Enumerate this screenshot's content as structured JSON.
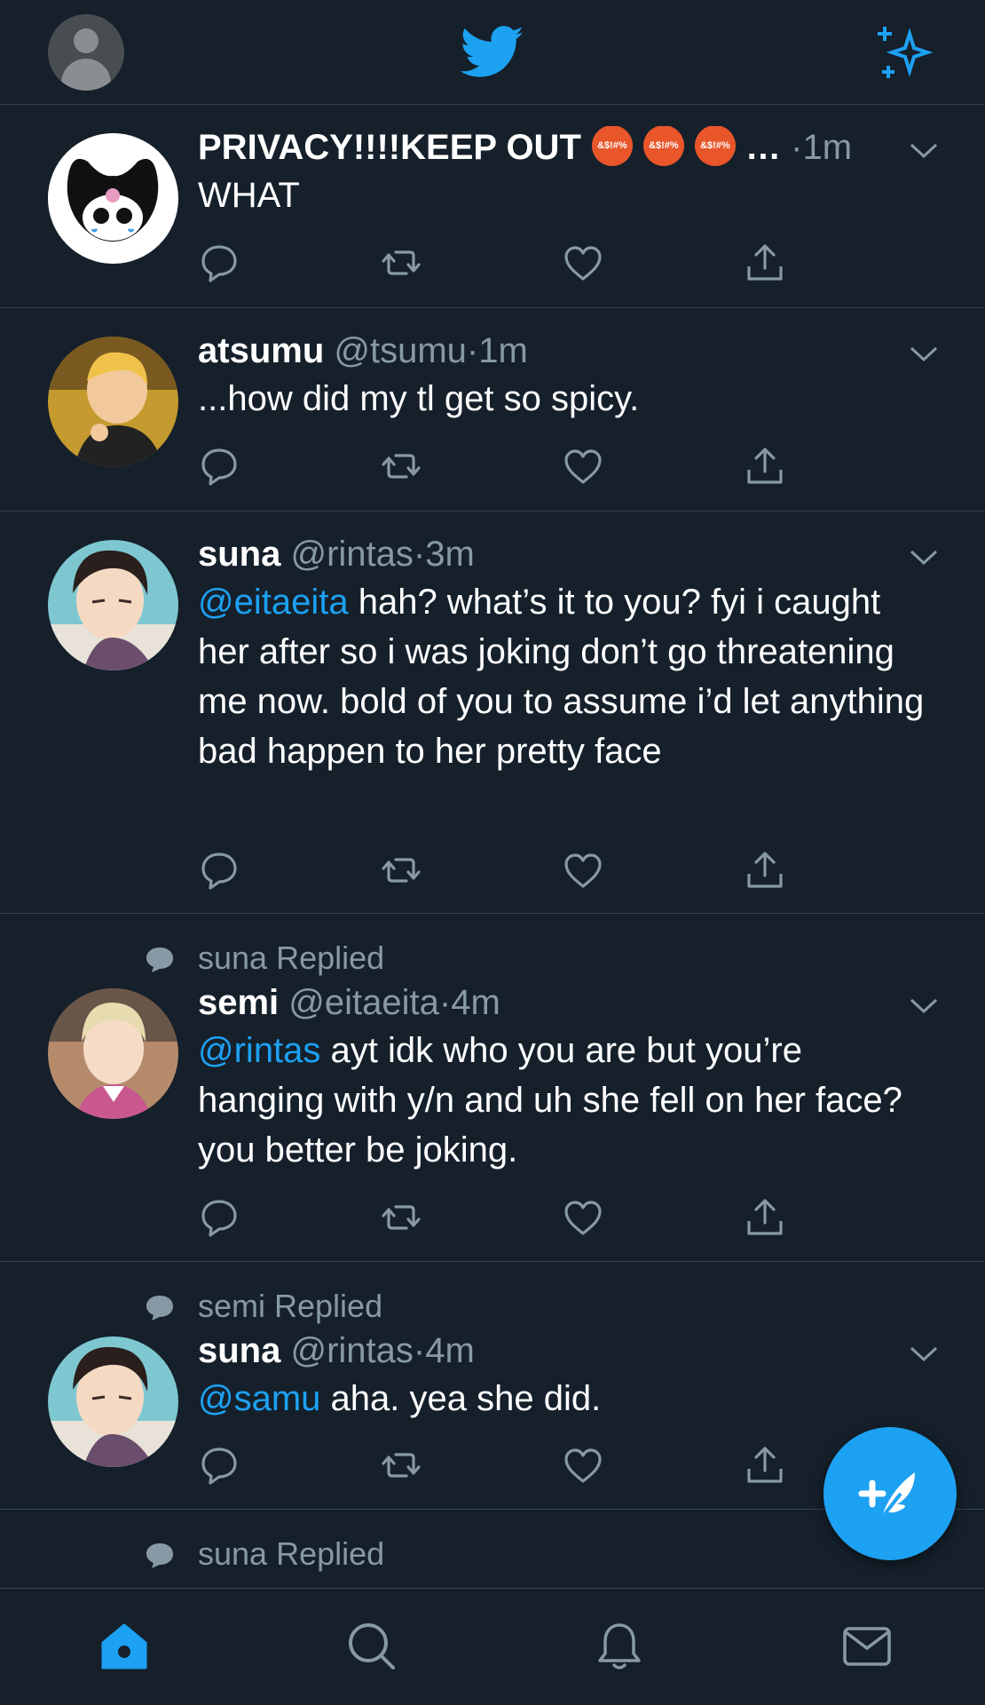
{
  "header": {
    "profile_icon": "profile-avatar-placeholder",
    "logo_icon": "twitter-bird-icon",
    "timeline_icon": "sparkle-icon",
    "accent_color": "#1da1f2"
  },
  "tweets": [
    {
      "name": "PRIVACY!!!!KEEP OUT",
      "emoji_text": "&$!#%",
      "ellipsis": "…",
      "handle": "",
      "dot": "·",
      "time": "1m",
      "text": "WHAT"
    },
    {
      "name": "atsumu",
      "handle": "@tsumu",
      "dot": "·",
      "time": "1m",
      "text": "...how did my tl get so spicy."
    },
    {
      "name": "suna",
      "handle": "@rintas",
      "dot": "·",
      "time": "3m",
      "mention": "@eitaeita",
      "text": " hah? what’s it to you? fyi i caught her after so i was joking don’t go threatening me now. bold of you to assume i’d let anything bad happen to her pretty face"
    },
    {
      "replied": "suna Replied",
      "name": "semi",
      "handle": "@eitaeita",
      "dot": "·",
      "time": "4m",
      "mention": "@rintas",
      "text": " ayt idk who you are but you’re hanging with y/n and uh she fell on her face? you better be joking."
    },
    {
      "replied": "semi Replied",
      "name": "suna",
      "handle": "@rintas",
      "dot": "·",
      "time": "4m",
      "mention": "@samu",
      "text": " aha. yea she did."
    },
    {
      "replied": "suna Replied"
    }
  ],
  "actions": [
    "reply-icon",
    "retweet-icon",
    "like-icon",
    "share-icon"
  ],
  "fab": {
    "icon": "compose-tweet-icon"
  },
  "bottom_nav": [
    "home-icon",
    "search-icon",
    "notifications-icon",
    "messages-icon"
  ]
}
